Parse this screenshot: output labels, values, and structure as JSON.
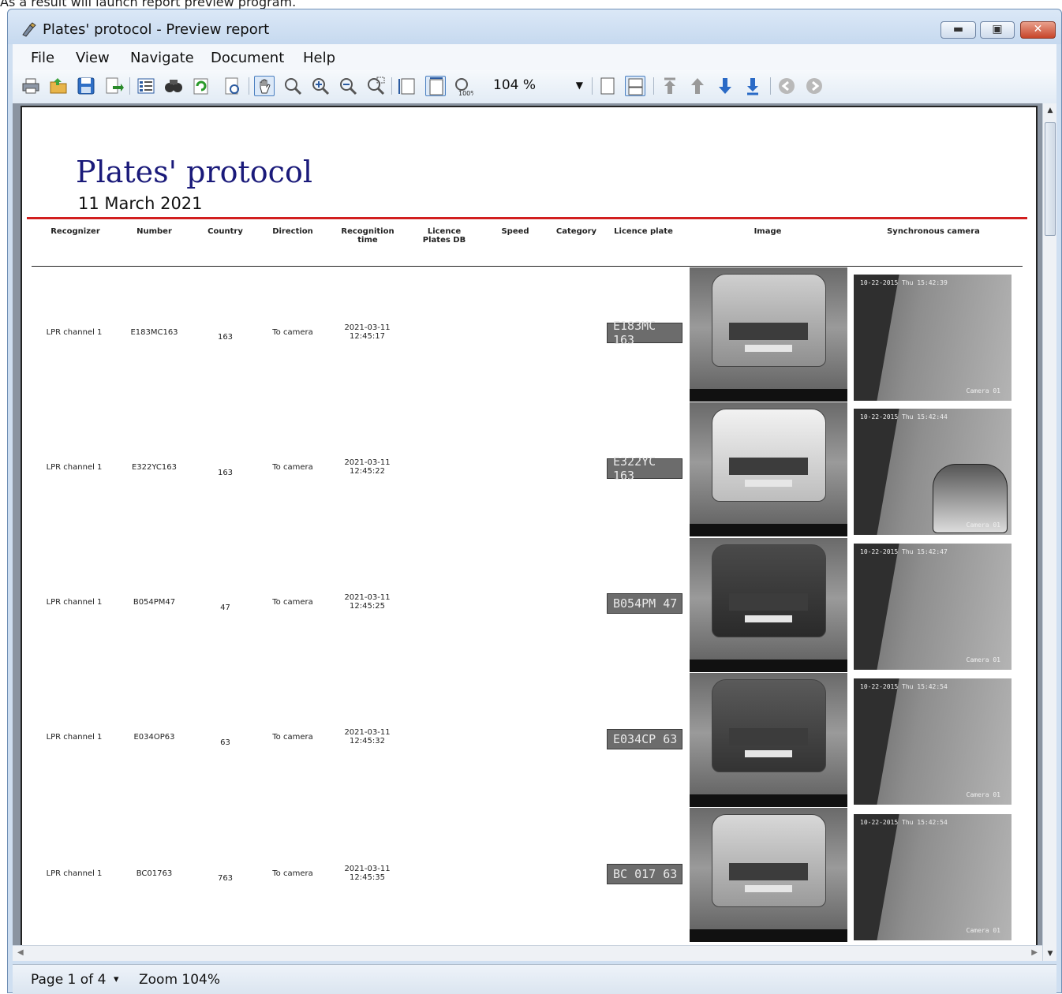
{
  "caption": "As a result will launch report preview program.",
  "window": {
    "title": "Plates' protocol - Preview report",
    "controls": {
      "minimize": "▬",
      "maximize": "▣",
      "close": "✕"
    }
  },
  "menu": [
    "File",
    "View",
    "Navigate",
    "Document",
    "Help"
  ],
  "toolbar": {
    "icons": [
      "print-icon",
      "open-icon",
      "save-icon",
      "export-icon",
      "outline-icon",
      "find-icon",
      "refresh-icon",
      "page-setup-icon",
      "hand-icon",
      "zoom-tool-icon",
      "zoom-in-icon",
      "zoom-out-icon",
      "zoom-region-icon",
      "page-width-icon",
      "whole-page-icon",
      "zoom-100-icon",
      "single-page-icon",
      "multi-page-icon",
      "first-page-icon",
      "prev-page-icon",
      "next-page-icon",
      "last-page-icon",
      "back-icon",
      "forward-icon"
    ],
    "zoom_value": "104 %"
  },
  "report": {
    "title": "Plates' protocol",
    "date": "11 March 2021",
    "columns": [
      "Recognizer",
      "Number",
      "Country",
      "Direction",
      "Recognition time",
      "Licence Plates DB",
      "Speed",
      "Category",
      "Licence plate",
      "Image",
      "Synchronous camera"
    ],
    "rows": [
      {
        "recognizer": "LPR channel  1",
        "number": "E183MC163",
        "country": "163",
        "direction": "To camera",
        "time_date": "2021-03-11",
        "time_clock": "12:45:17",
        "plate": "E183MC 163",
        "cam_ts": "10-22-2015 Thu 15:42:39",
        "cam_label": "Camera 01"
      },
      {
        "recognizer": "LPR channel  1",
        "number": "E322YC163",
        "country": "163",
        "direction": "To camera",
        "time_date": "2021-03-11",
        "time_clock": "12:45:22",
        "plate": "E322YC 163",
        "cam_ts": "10-22-2015 Thu 15:42:44",
        "cam_label": "Camera 01"
      },
      {
        "recognizer": "LPR channel  1",
        "number": "B054PM47",
        "country": "47",
        "direction": "To camera",
        "time_date": "2021-03-11",
        "time_clock": "12:45:25",
        "plate": "B054PM 47",
        "cam_ts": "10-22-2015 Thu 15:42:47",
        "cam_label": "Camera 01"
      },
      {
        "recognizer": "LPR channel  1",
        "number": "E034OP63",
        "country": "63",
        "direction": "To camera",
        "time_date": "2021-03-11",
        "time_clock": "12:45:32",
        "plate": "E034CP 63",
        "cam_ts": "10-22-2015 Thu 15:42:54",
        "cam_label": "Camera 01"
      },
      {
        "recognizer": "LPR channel  1",
        "number": "BC01763",
        "country": "763",
        "direction": "To camera",
        "time_date": "2021-03-11",
        "time_clock": "12:45:35",
        "plate": "BC 017 63",
        "cam_ts": "10-22-2015 Thu 15:42:54",
        "cam_label": "Camera 01"
      }
    ]
  },
  "status": {
    "page": "Page 1 of 4",
    "page_dropdown": "▾",
    "zoom": "Zoom 104%"
  },
  "colors": {
    "title_blue": "#1a1a7a",
    "divider_red": "#d21f1f",
    "window_frame": "#cfdff1"
  }
}
